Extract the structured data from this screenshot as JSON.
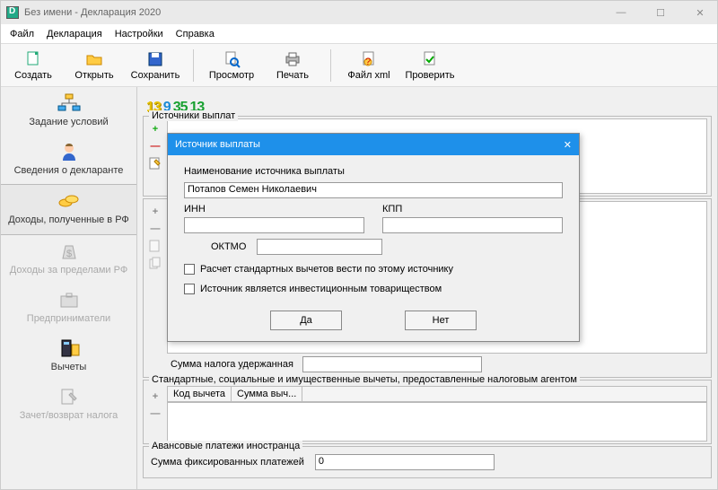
{
  "title": "Без имени - Декларация 2020",
  "menu": {
    "file": "Файл",
    "decl": "Декларация",
    "settings": "Настройки",
    "help": "Справка"
  },
  "toolbar": {
    "create": "Создать",
    "open": "Открыть",
    "save": "Сохранить",
    "preview": "Просмотр",
    "print": "Печать",
    "filexml": "Файл xml",
    "check": "Проверить"
  },
  "nav": {
    "conditions": "Задание условий",
    "declarant": "Сведения о декларанте",
    "income_rf": "Доходы, полученные в РФ",
    "income_abroad": "Доходы за пределами РФ",
    "entrepreneurs": "Предприниматели",
    "deductions": "Вычеты",
    "offset": "Зачет/возврат налога"
  },
  "tabs": {
    "t1": "13",
    "t2": "9",
    "t3": "35",
    "t4": "13"
  },
  "sections": {
    "sources": "Источники выплат",
    "tax_withheld": "Сумма налога удержанная",
    "std_deductions": "Стандартные, социальные и имущественные вычеты, предоставленные налоговым агентом",
    "col_code": "Код вычета",
    "col_sum": "Сумма выч...",
    "advance": "Авансовые платежи иностранца",
    "advance_label": "Сумма фиксированных платежей",
    "advance_value": "0"
  },
  "dialog": {
    "title": "Источник выплаты",
    "src_name_label": "Наименование источника выплаты",
    "src_name_value": "Потапов Семен Николаевич",
    "inn": "ИНН",
    "kpp": "КПП",
    "oktmo": "ОКТМО",
    "chk1": "Расчет стандартных вычетов вести по этому источнику",
    "chk2": "Источник является инвестиционным товариществом",
    "yes": "Да",
    "no": "Нет"
  }
}
